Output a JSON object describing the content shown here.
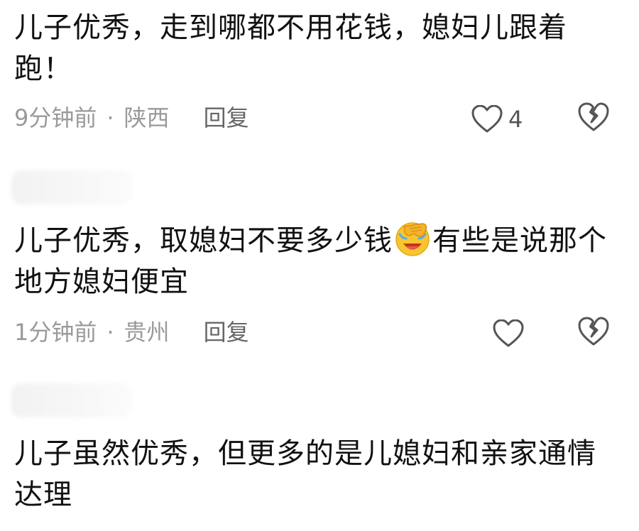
{
  "comments": [
    {
      "text": "儿子优秀，走到哪都不用花钱，媳妇儿跟着跑！",
      "time": "9分钟前",
      "separator": "·",
      "location": "陕西",
      "reply_label": "回复",
      "like_count": "4"
    },
    {
      "text_before_emoji": "儿子优秀，取媳妇不要多少钱",
      "emoji": "face-palm-laughing-emoji",
      "text_after_emoji": "有些是说那个地方媳妇便宜",
      "time": "1分钟前",
      "separator": "·",
      "location": "贵州",
      "reply_label": "回复",
      "like_count": ""
    },
    {
      "text": "儿子虽然优秀，但更多的是儿媳妇和亲家通情达理"
    }
  ],
  "icons": {
    "like": "heart-outline-icon",
    "dislike": "broken-heart-icon"
  },
  "colors": {
    "text": "#111111",
    "meta": "#9a9a9a",
    "icon": "#555555",
    "emoji": "#f7c62e"
  }
}
